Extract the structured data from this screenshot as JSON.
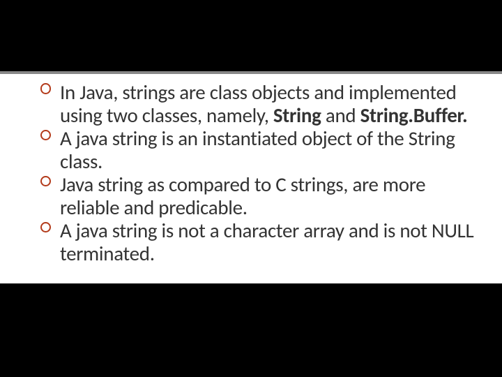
{
  "bullets": {
    "b1": {
      "t1": "In Java, strings are class objects and implemented using two classes, namely, ",
      "s1": "String ",
      "t2": "and ",
      "s2": "String.Buffer."
    },
    "b2": "A java string is an instantiated object of the String class.",
    "b3": "Java string as compared to C strings, are more reliable and predicable.",
    "b4": "A java string is not a character array and is not NULL terminated."
  }
}
